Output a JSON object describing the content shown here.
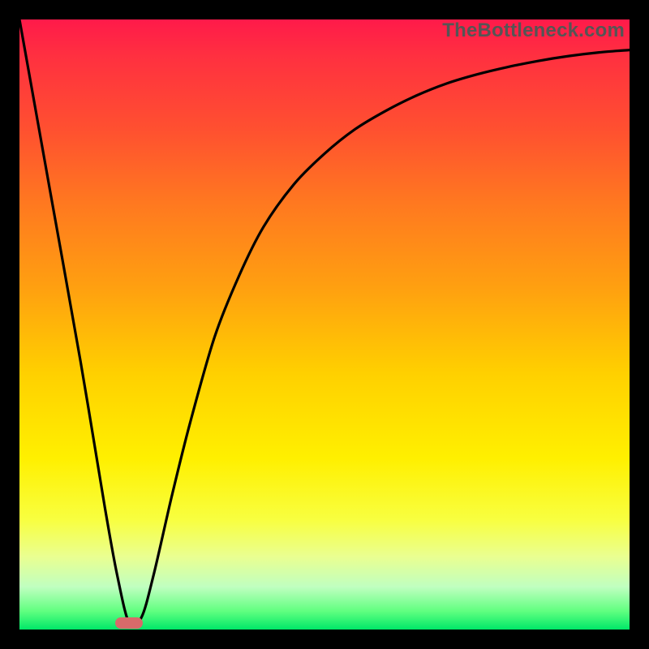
{
  "watermark": "TheBottleneck.com",
  "chart_data": {
    "type": "line",
    "title": "",
    "xlabel": "",
    "ylabel": "",
    "xlim": [
      0,
      100
    ],
    "ylim": [
      0,
      100
    ],
    "grid": false,
    "legend": false,
    "series": [
      {
        "name": "bottleneck-curve",
        "x": [
          0,
          5,
          10,
          14,
          16,
          18,
          20,
          22,
          25,
          28,
          32,
          36,
          40,
          45,
          50,
          55,
          60,
          65,
          70,
          75,
          80,
          85,
          90,
          95,
          100
        ],
        "values": [
          100,
          72,
          44,
          20,
          9,
          1,
          2,
          9,
          22,
          34,
          48,
          58,
          66,
          73,
          78,
          82,
          85,
          87.5,
          89.5,
          91,
          92.2,
          93.2,
          94,
          94.6,
          95
        ]
      }
    ],
    "marker": {
      "x": 18,
      "y": 1,
      "label": "optimal-point"
    },
    "gradient_stops": [
      {
        "pos": 0,
        "color": "#ff1a4a"
      },
      {
        "pos": 18,
        "color": "#ff5030"
      },
      {
        "pos": 44,
        "color": "#ffa010"
      },
      {
        "pos": 72,
        "color": "#fff000"
      },
      {
        "pos": 93,
        "color": "#c0ffc0"
      },
      {
        "pos": 100,
        "color": "#00e868"
      }
    ]
  }
}
